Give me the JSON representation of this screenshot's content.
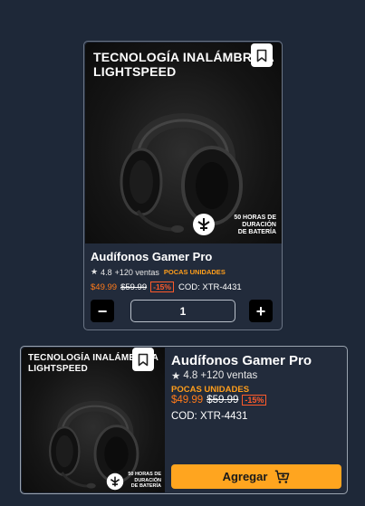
{
  "products": [
    {
      "image_headline_line1": "TECNOLOGÍA INALÁMBRICA",
      "image_headline_line2": "LIGHTSPEED",
      "image_badge_line1": "50 HORAS DE",
      "image_badge_line2": "DURACIÓN",
      "image_badge_line3": "DE BATERÍA",
      "title": "Audífonos Gamer Pro",
      "star": "★",
      "rating": "4.8",
      "sales": "+120 ventas",
      "stock_label": "POCAS UNIDADES",
      "price": "$49.99",
      "old_price": "$59.99",
      "discount": "-15%",
      "code": "COD: XTR-4431",
      "quantity": "1",
      "minus_label": "−",
      "plus_label": "+"
    },
    {
      "image_headline_line1": "TECNOLOGÍA INALÁMBRICA",
      "image_headline_line2": "LIGHTSPEED",
      "image_badge_line1": "50 HORAS DE",
      "image_badge_line2": "DURACIÓN",
      "image_badge_line3": "DE BATERÍA",
      "title": "Audífonos Gamer Pro",
      "star": "★",
      "rating": "4.8",
      "sales": "+120 ventas",
      "stock_label": "POCAS UNIDADES",
      "price": "$49.99",
      "old_price": "$59.99",
      "discount": "-15%",
      "code": "COD: XTR-4431",
      "add_button_label": "Agregar"
    }
  ],
  "icons": {
    "bookmark": "bookmark-icon",
    "cart": "cart-plus-icon",
    "brand_logo": "logitech-g-logo"
  },
  "colors": {
    "background": "#1e2838",
    "card": "#222b3b",
    "accent_orange": "#ff7a1a",
    "stock_orange": "#ff9e1b",
    "button_yellow": "#ffa51f"
  }
}
